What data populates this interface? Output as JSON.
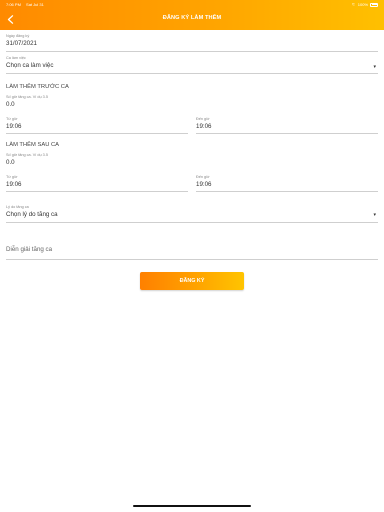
{
  "status_bar": {
    "time": "7:06 PM",
    "date": "Sat Jul 31",
    "battery": "100%"
  },
  "header": {
    "title": "ĐĂNG KÝ LÀM THÊM"
  },
  "form": {
    "date_field": {
      "label": "Ngày đăng ký",
      "value": "31/07/2021"
    },
    "shift_field": {
      "label": "Ca làm việc",
      "value": "Chọn ca làm việc"
    },
    "before_section": {
      "title": "LÀM THÊM TRƯỚC CA",
      "hours": {
        "label": "Số giờ tăng ca. Ví dụ 3.5",
        "value": "0.0"
      },
      "from": {
        "label": "Từ giờ",
        "value": "19:06"
      },
      "to": {
        "label": "Đến giờ",
        "value": "19:06"
      }
    },
    "after_section": {
      "title": "LÀM THÊM SAU CA",
      "hours": {
        "label": "Số giờ tăng ca. Ví dụ 3.5",
        "value": "0.0"
      },
      "from": {
        "label": "Từ giờ",
        "value": "19:06"
      },
      "to": {
        "label": "Đến giờ",
        "value": "19:06"
      }
    },
    "reason_field": {
      "label": "Lý do tăng ca",
      "value": "Chọn lý do tăng ca"
    },
    "explanation_field": {
      "placeholder": "Diễn giải tăng ca"
    },
    "submit_label": "ĐĂNG KÝ"
  },
  "colors": {
    "accent_start": "#ff8a00",
    "accent_end": "#ffc000"
  }
}
